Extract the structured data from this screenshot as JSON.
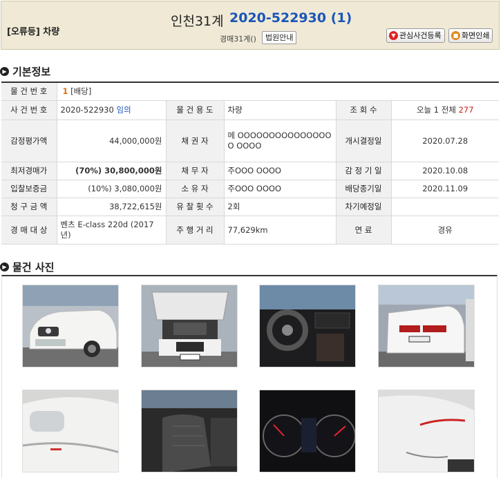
{
  "header": {
    "category": "[오류등] 차량",
    "court": "인천31계",
    "case_no": "2020-522930 (1)",
    "sub_label": "경매31계()",
    "court_info_button": "법원안내",
    "favorite_button": "관심사건등록",
    "print_button": "화면인쇄"
  },
  "basic_info": {
    "title": "기본정보",
    "item_no_label": "물 건 번 호",
    "item_no_value": "1",
    "item_no_extra": "[배당]",
    "rows": [
      {
        "l1": "사 건 번 호",
        "v1": "2020-522930",
        "v1b": "임의",
        "l2": "물 건 용 도",
        "v2": "차량",
        "l3": "조 회 수",
        "v3a": "오늘 1   전체",
        "v3b": "277"
      },
      {
        "l1": "감정평가액",
        "v1": "44,000,000원",
        "l2": "채 권 자",
        "v2": "메 OOOOOOOOOOOOOOOO OOOO",
        "l3": "개시결정일",
        "v3": "2020.07.28"
      },
      {
        "l1": "최저경매가",
        "v1": "(70%) 30,800,000원",
        "l2": "채 무 자",
        "v2": "주OOO OOOO",
        "l3": "감 정 기 일",
        "v3": "2020.10.08"
      },
      {
        "l1": "입찰보증금",
        "v1": "(10%) 3,080,000원",
        "l2": "소 유 자",
        "v2": "주OOO OOOO",
        "l3": "배당종기일",
        "v3": "2020.11.09"
      },
      {
        "l1": "청 구 금 액",
        "v1": "38,722,615원",
        "l2": "유 찰 횟 수",
        "v2": "2회",
        "l3": "차기예정일",
        "v3": ""
      },
      {
        "l1": "경 매 대 상",
        "v1": "벤츠 E-class 220d (2017년)",
        "l2": "주 행 거 리",
        "v2": "77,629km",
        "l3": "연 료",
        "v3": "경유"
      }
    ]
  },
  "photos_section": {
    "title": "물건 사진"
  },
  "colors": {
    "accent_blue": "#1a55b8",
    "header_bg": "#efe9d6",
    "highlight_orange": "#e06e00",
    "view_count_red": "#cc2222"
  }
}
